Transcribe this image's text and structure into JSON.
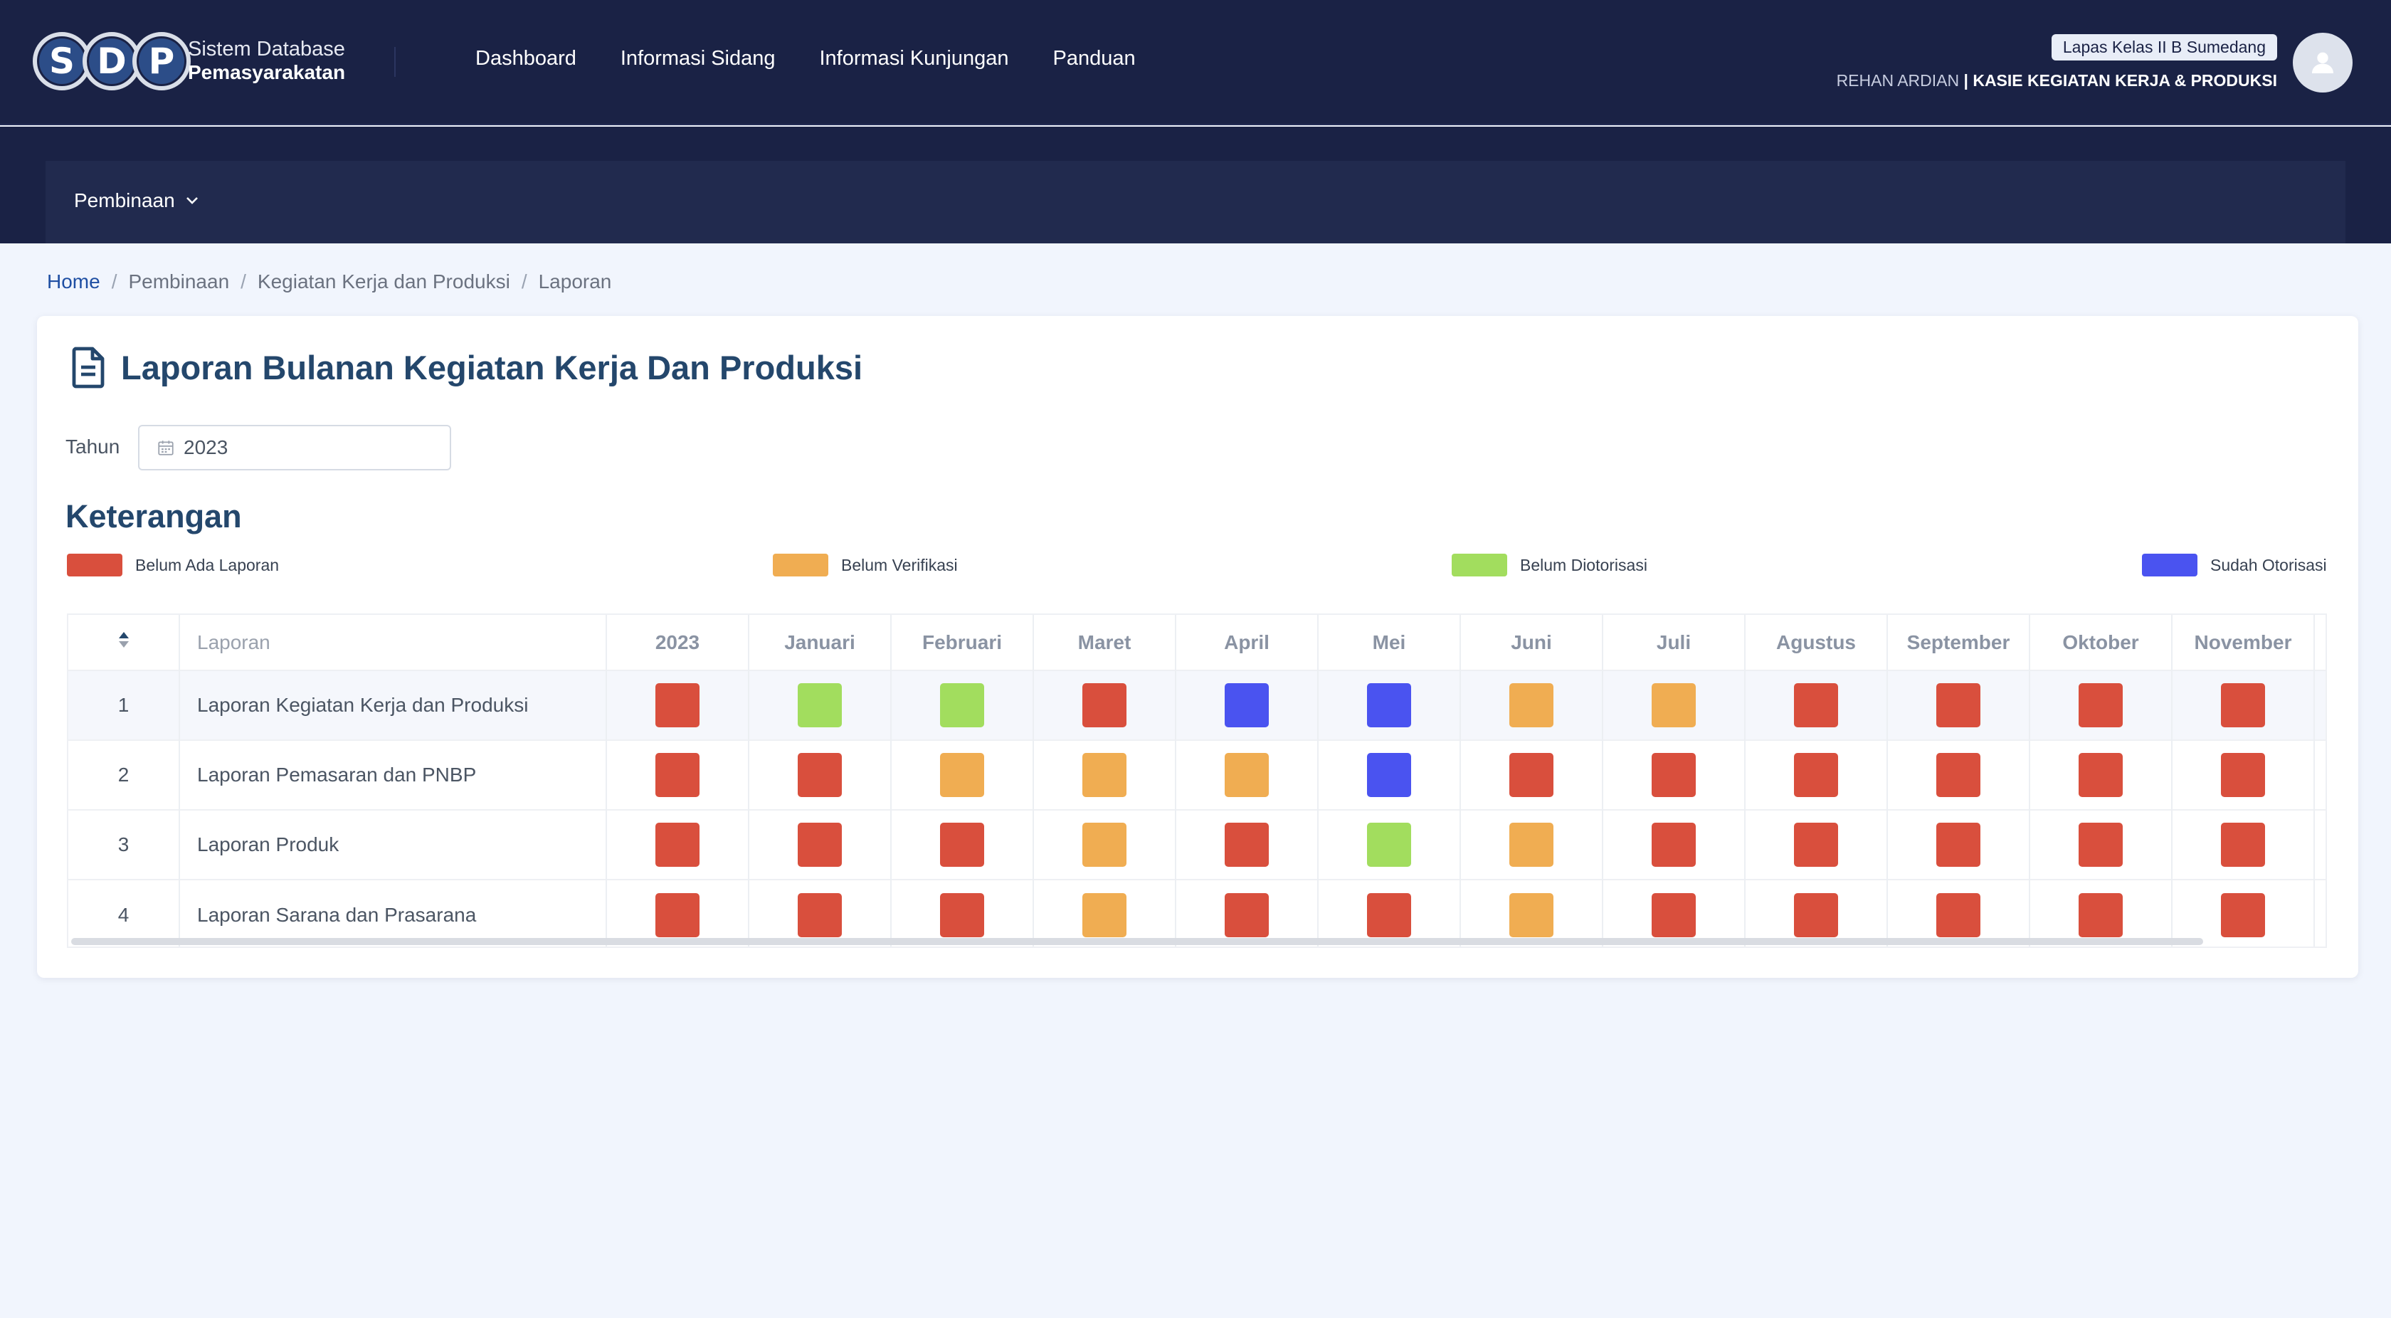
{
  "header": {
    "logo_letters": [
      "S",
      "D",
      "P"
    ],
    "brand_line1": "Sistem Database",
    "brand_line2": "Pemasyarakatan",
    "nav": [
      "Dashboard",
      "Informasi Sidang",
      "Informasi Kunjungan",
      "Panduan"
    ],
    "unit_badge": "Lapas Kelas II B Sumedang",
    "user_name": "REHAN ARDIAN",
    "user_sep": "|",
    "user_role": "KASIE KEGIATAN KERJA & PRODUKSI",
    "avatar_icon": "user-icon"
  },
  "subnav": {
    "menu_label": "Pembinaan"
  },
  "breadcrumb": {
    "home": "Home",
    "level1": "Pembinaan",
    "level2": "Kegiatan Kerja dan Produksi",
    "current": "Laporan",
    "separator": "/"
  },
  "page": {
    "title": "Laporan Bulanan Kegiatan Kerja Dan Produksi",
    "title_icon": "document-icon",
    "tahun_label": "Tahun",
    "tahun_value": "2023",
    "calendar_icon": "calendar-icon",
    "keterangan_title": "Keterangan"
  },
  "legend": [
    {
      "label": "Belum Ada Laporan",
      "color": "#d94f3d"
    },
    {
      "label": "Belum Verifikasi",
      "color": "#f0ad52"
    },
    {
      "label": "Belum Diotorisasi",
      "color": "#a2dd5e"
    },
    {
      "label": "Sudah Otorisasi",
      "color": "#4a53f0"
    }
  ],
  "colors": {
    "R": "#d94f3d",
    "O": "#f0ad52",
    "G": "#a2dd5e",
    "B": "#4a53f0"
  },
  "table": {
    "columns": [
      "",
      "Laporan",
      "2023",
      "Januari",
      "Februari",
      "Maret",
      "April",
      "Mei",
      "Juni",
      "Juli",
      "Agustus",
      "September",
      "Oktober",
      "November"
    ],
    "rows": [
      {
        "no": "1",
        "name": "Laporan Kegiatan Kerja dan Produksi",
        "status": [
          "R",
          "G",
          "G",
          "R",
          "B",
          "B",
          "O",
          "O",
          "R",
          "R",
          "R",
          "R"
        ]
      },
      {
        "no": "2",
        "name": "Laporan Pemasaran dan PNBP",
        "status": [
          "R",
          "R",
          "O",
          "O",
          "O",
          "B",
          "R",
          "R",
          "R",
          "R",
          "R",
          "R"
        ]
      },
      {
        "no": "3",
        "name": "Laporan Produk",
        "status": [
          "R",
          "R",
          "R",
          "O",
          "R",
          "G",
          "O",
          "R",
          "R",
          "R",
          "R",
          "R"
        ]
      },
      {
        "no": "4",
        "name": "Laporan Sarana dan Prasarana",
        "status": [
          "R",
          "R",
          "R",
          "O",
          "R",
          "R",
          "O",
          "R",
          "R",
          "R",
          "R",
          "R"
        ]
      }
    ]
  }
}
